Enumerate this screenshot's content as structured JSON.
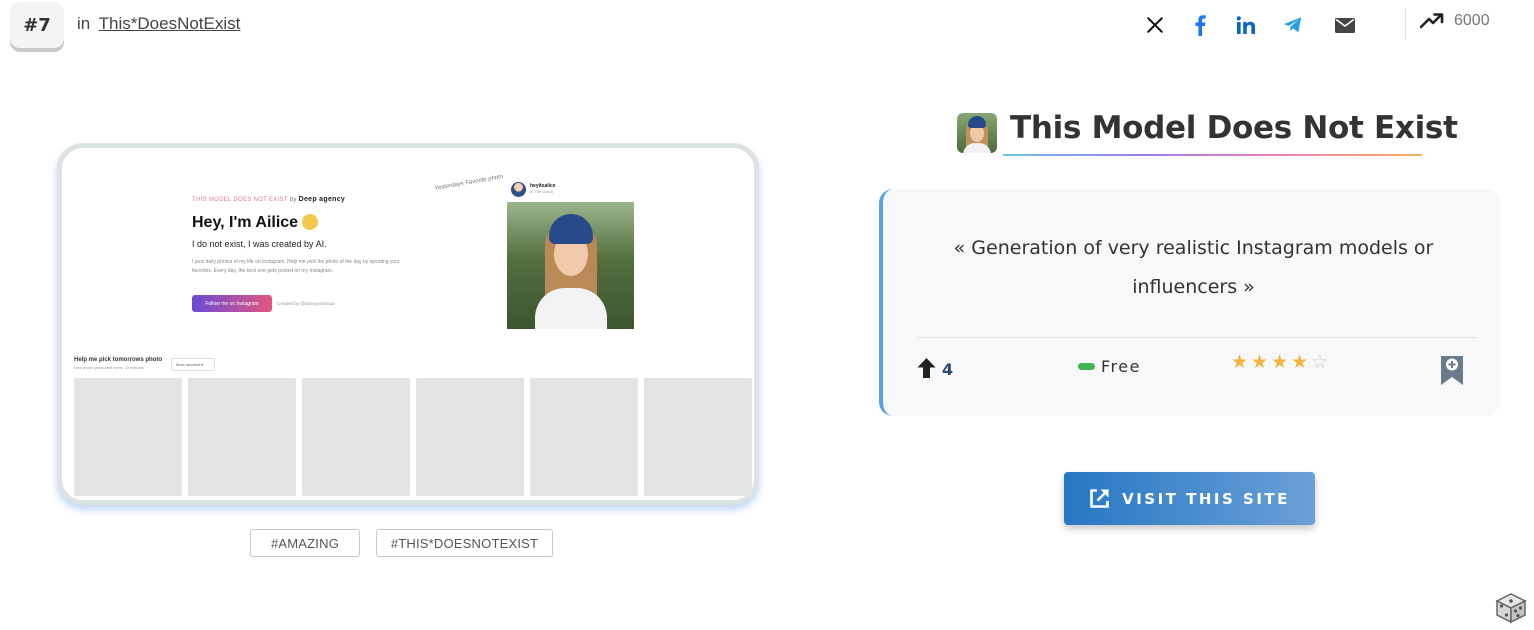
{
  "rank": {
    "label": "#7"
  },
  "category": {
    "prefix": "in",
    "link": "This*DoesNotExist"
  },
  "share": {
    "icons": [
      "x-icon",
      "facebook-icon",
      "linkedin-icon",
      "telegram-icon",
      "mail-icon"
    ],
    "colors": {
      "x": "#111111",
      "facebook": "#1877f2",
      "linkedin": "#0a66c2",
      "telegram": "#2aa0da",
      "mail": "#444444"
    }
  },
  "trend": {
    "icon": "trending-up-icon",
    "count": "6000"
  },
  "preview": {
    "header": "THIS MODEL DOES NOT EXIST",
    "by": "by",
    "agency": "Deep agency",
    "greeting": "Hey, I'm Ailice",
    "subtitle": "I do not exist, I was created by AI.",
    "description": "I post daily photos of my life on Instagram. Help me pick the photo of the day by upvoting your favorites. Every day, the best one gets posted on my Instagram.",
    "follow_button": "Follow me on Instagram",
    "created_by": "Created by @dannypostmaa",
    "note": "Yesterdays Favorite photo",
    "profile_handle": "heyitsalice",
    "profile_sub": "In The Cloud",
    "vote_title": "Help me pick tomorrows photo",
    "vote_sub": "New photo generated every 15 minutes",
    "sort_select": "Most upvoted"
  },
  "tags": [
    "#AMAZING",
    "#THIS*DOESNOTEXIST"
  ],
  "tool": {
    "title": "This Model Does Not Exist",
    "description": "« Generation of very realistic Instagram models or influencers »",
    "upvotes": "4",
    "pricing": "Free",
    "rating": 4,
    "rating_max": 5,
    "visit_label": "VISIT THIS SITE"
  },
  "colors": {
    "accent": "#5aa0e6",
    "button_start": "#2677c4",
    "button_end": "#6ba0d6",
    "price_green": "#3fb54f",
    "star": "#f3b33d"
  }
}
